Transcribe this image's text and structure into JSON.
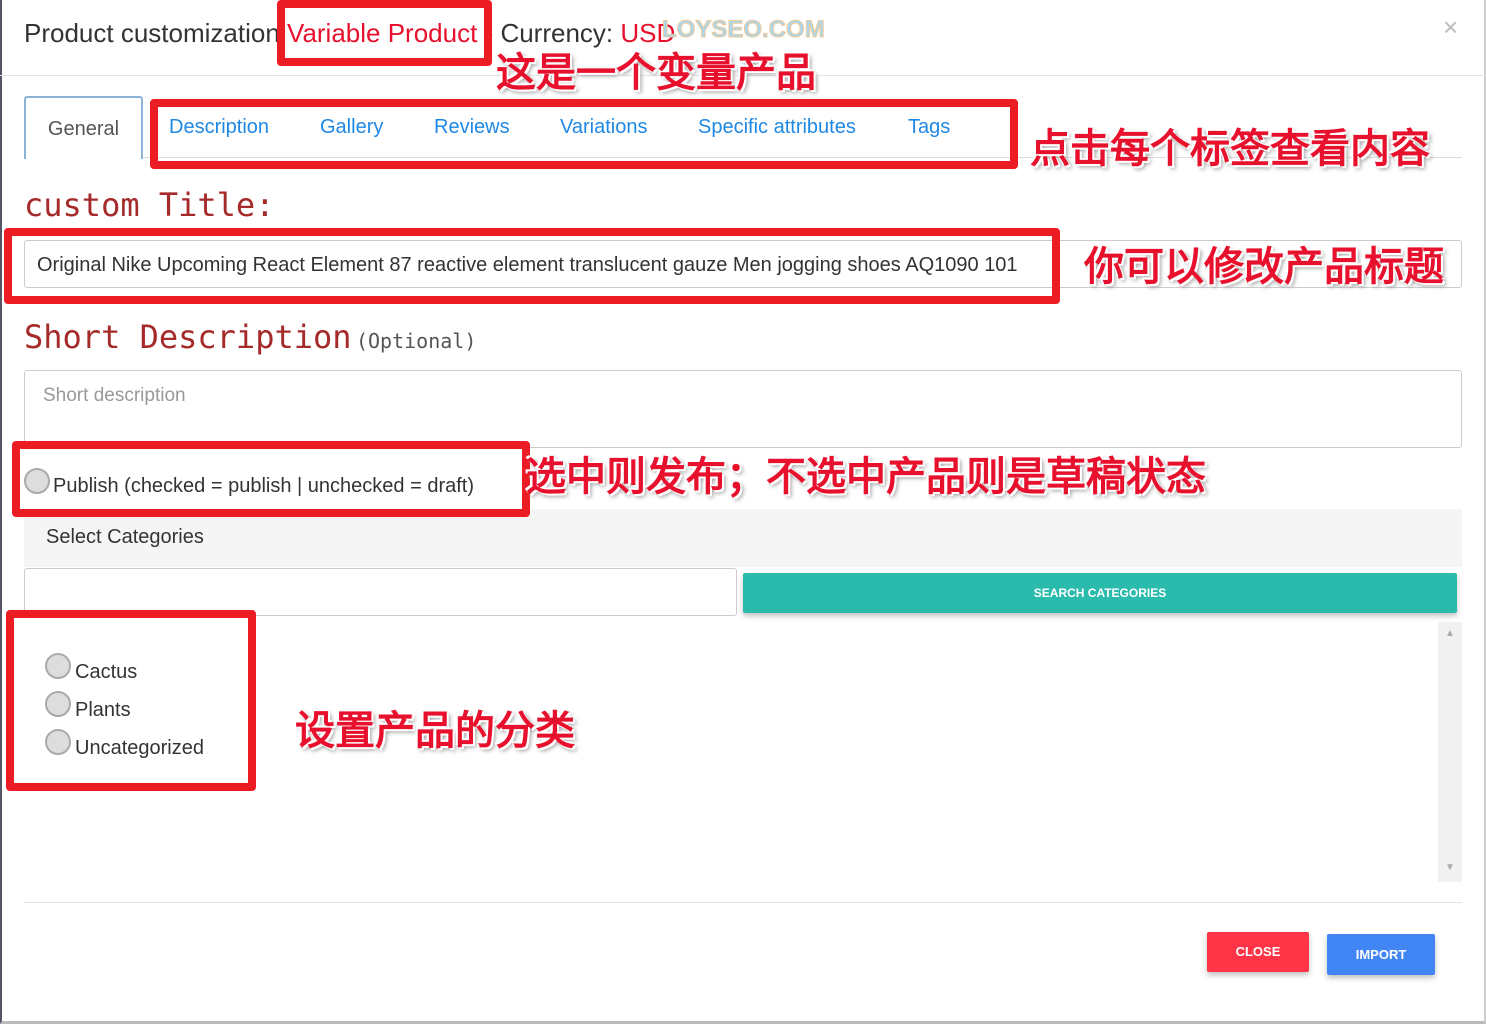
{
  "header": {
    "title_prefix": "Product customization",
    "product_type": "Variable Product",
    "currency_label": "- Currency:",
    "currency": "USD",
    "close_icon": "×",
    "watermark": "LOYSEO.COM"
  },
  "tabs": [
    {
      "label": "General"
    },
    {
      "label": "Description"
    },
    {
      "label": "Gallery"
    },
    {
      "label": "Reviews"
    },
    {
      "label": "Variations"
    },
    {
      "label": "Specific attributes"
    },
    {
      "label": "Tags"
    }
  ],
  "general": {
    "custom_title_label": "custom Title:",
    "custom_title_value": "Original Nike Upcoming React Element 87 reactive element translucent gauze Men jogging shoes AQ1090 101",
    "short_desc_label": "Short Description",
    "short_desc_optional": "(Optional)",
    "short_desc_placeholder": "Short description",
    "publish_label": "Publish (checked = publish | unchecked = draft)",
    "publish_checked": false,
    "categories_header": "Select Categories",
    "category_search_value": "",
    "search_categories_button": "SEARCH CATEGORIES",
    "categories": [
      {
        "label": "Cactus",
        "checked": false
      },
      {
        "label": "Plants",
        "checked": false
      },
      {
        "label": "Uncategorized",
        "checked": false
      }
    ]
  },
  "footer": {
    "close_button": "CLOSE",
    "import_button": "IMPORT"
  },
  "annotations": {
    "variable_product": "这是一个变量产品",
    "tabs": "点击每个标签查看内容",
    "title": "你可以修改产品标题",
    "publish": "选中则发布；不选中产品则是草稿状态",
    "categories": "设置产品的分类"
  },
  "colors": {
    "accent": "#1e88e5",
    "search_button": "#2bbbad",
    "close_button": "#ff3547",
    "import_button": "#4285f4",
    "annotation": "#ec1c24"
  }
}
